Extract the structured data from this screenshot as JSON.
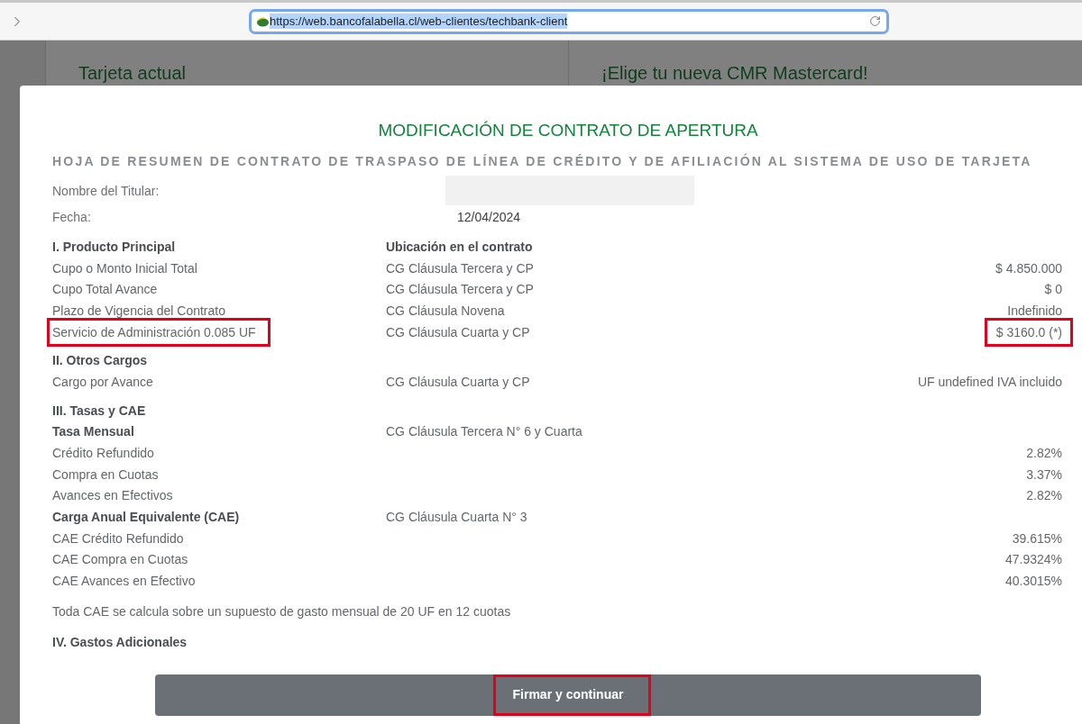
{
  "browser": {
    "url": "https://web.bancofalabella.cl/web-clientes/techbank-client",
    "url_text_selected": true
  },
  "background_page": {
    "cards": [
      {
        "title": "Tarjeta actual"
      },
      {
        "title": "¡Elige tu nueva CMR Mastercard!"
      }
    ]
  },
  "modal": {
    "title": "MODIFICACIÓN DE CONTRATO DE APERTURA",
    "subtitle": "HOJA DE RESUMEN DE CONTRATO DE TRASPASO DE LÍNEA DE CRÉDITO Y DE AFILIACIÓN AL SISTEMA DE USO DE TARJETA",
    "fields": [
      {
        "label": "Nombre del Titular:",
        "redacted": true
      },
      {
        "label": "Fecha:",
        "value": "12/04/2024",
        "redacted": false
      }
    ],
    "rows": [
      {
        "kind": "section",
        "label": "I. Producto Principal",
        "location": "Ubicación en el contrato",
        "marked_label": false,
        "marked_value": false
      },
      {
        "kind": "item",
        "label": "Cupo o Monto Inicial Total",
        "location": "CG Cláusula Tercera y CP",
        "value": "$ 4.850.000",
        "marked_label": false,
        "marked_value": false
      },
      {
        "kind": "item",
        "label": "Cupo Total Avance",
        "location": "CG Cláusula Tercera y CP",
        "value": "$ 0",
        "marked_label": false,
        "marked_value": false
      },
      {
        "kind": "item",
        "label": "Plazo de Vigencia del Contrato",
        "location": "CG Cláusula Novena",
        "value": "Indefinido",
        "marked_label": false,
        "marked_value": false
      },
      {
        "kind": "item",
        "label": "Servicio de Administración 0.085 UF",
        "location": "CG Cláusula Cuarta y CP",
        "value": "$ 3160.0 (*)",
        "marked_label": true,
        "marked_value": true
      },
      {
        "kind": "section",
        "label": "II. Otros Cargos",
        "marked_label": false,
        "marked_value": false
      },
      {
        "kind": "item",
        "label": "Cargo por Avance",
        "location": "CG Cláusula Cuarta y CP",
        "value": "UF undefined IVA incluido",
        "marked_label": false,
        "marked_value": false
      },
      {
        "kind": "section",
        "label": "III. Tasas y CAE",
        "marked_label": false,
        "marked_value": false
      },
      {
        "kind": "subsection",
        "label": "Tasa Mensual",
        "location": "CG Cláusula Tercera N° 6 y Cuarta",
        "marked_label": false,
        "marked_value": false
      },
      {
        "kind": "item",
        "label": "Crédito Refundido",
        "value": "2.82%",
        "marked_label": false,
        "marked_value": false
      },
      {
        "kind": "item",
        "label": "Compra en Cuotas",
        "value": "3.37%",
        "marked_label": false,
        "marked_value": false
      },
      {
        "kind": "item",
        "label": "Avances en Efectivos",
        "value": "2.82%",
        "marked_label": false,
        "marked_value": false
      },
      {
        "kind": "subsection",
        "label": "Carga Anual Equivalente (CAE)",
        "location": "CG Cláusula Cuarta N° 3",
        "marked_label": false,
        "marked_value": false
      },
      {
        "kind": "item",
        "label": "CAE Crédito Refundido",
        "value": "39.615%",
        "marked_label": false,
        "marked_value": false
      },
      {
        "kind": "item",
        "label": "CAE Compra en Cuotas",
        "value": "47.9324%",
        "marked_label": false,
        "marked_value": false
      },
      {
        "kind": "item",
        "label": "CAE Avances en Efectivo",
        "value": "40.3015%",
        "marked_label": false,
        "marked_value": false
      },
      {
        "kind": "note",
        "label": "Toda CAE se calcula sobre un supuesto de gasto mensual de 20 UF en 12 cuotas",
        "marked_label": false,
        "marked_value": false
      },
      {
        "kind": "section",
        "label": "IV. Gastos Adicionales",
        "marked_label": false,
        "marked_value": false
      }
    ],
    "button": {
      "label": "Firmar y continuar",
      "marked": true
    }
  }
}
